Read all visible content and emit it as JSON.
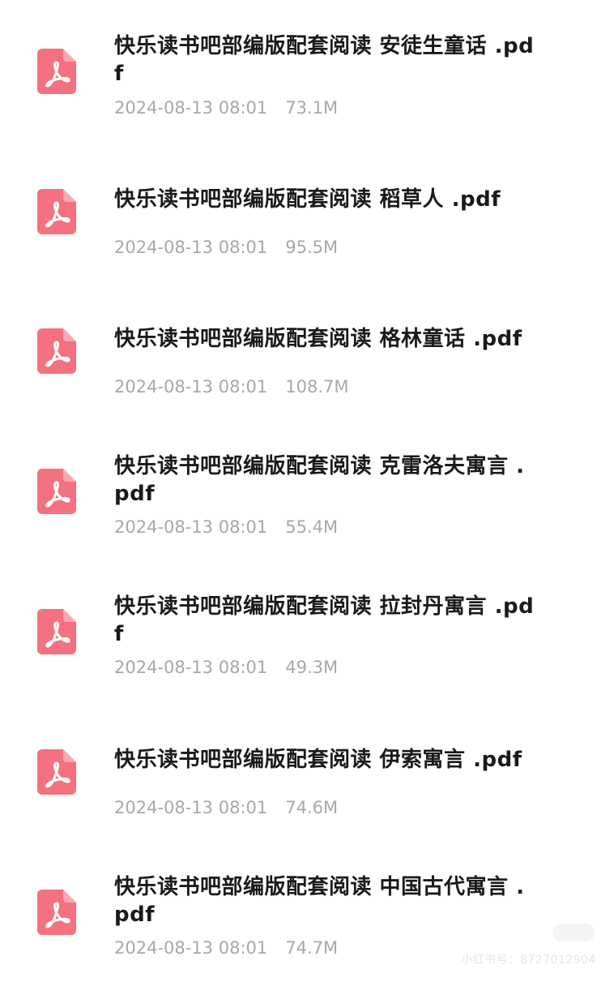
{
  "colors": {
    "pdf_icon": "#f4717f",
    "title_text": "#1a1a1a",
    "meta_text": "#a8a8a8"
  },
  "files": [
    {
      "icon": "pdf-icon",
      "name": "快乐读书吧部编版配套阅读 安徒生童话 .pdf",
      "date": "2024-08-13 08:01",
      "size": "73.1M"
    },
    {
      "icon": "pdf-icon",
      "name": "快乐读书吧部编版配套阅读 稻草人 .pdf",
      "date": "2024-08-13 08:01",
      "size": "95.5M"
    },
    {
      "icon": "pdf-icon",
      "name": "快乐读书吧部编版配套阅读 格林童话 .pdf",
      "date": "2024-08-13 08:01",
      "size": "108.7M"
    },
    {
      "icon": "pdf-icon",
      "name": "快乐读书吧部编版配套阅读 克雷洛夫寓言 .pdf",
      "date": "2024-08-13 08:01",
      "size": "55.4M"
    },
    {
      "icon": "pdf-icon",
      "name": "快乐读书吧部编版配套阅读 拉封丹寓言 .pdf",
      "date": "2024-08-13 08:01",
      "size": "49.3M"
    },
    {
      "icon": "pdf-icon",
      "name": "快乐读书吧部编版配套阅读 伊索寓言 .pdf",
      "date": "2024-08-13 08:01",
      "size": "74.6M"
    },
    {
      "icon": "pdf-icon",
      "name": "快乐读书吧部编版配套阅读 中国古代寓言 .pdf",
      "date": "2024-08-13 08:01",
      "size": "74.7M"
    }
  ],
  "watermark": {
    "text": "小红书号：8727012904"
  }
}
